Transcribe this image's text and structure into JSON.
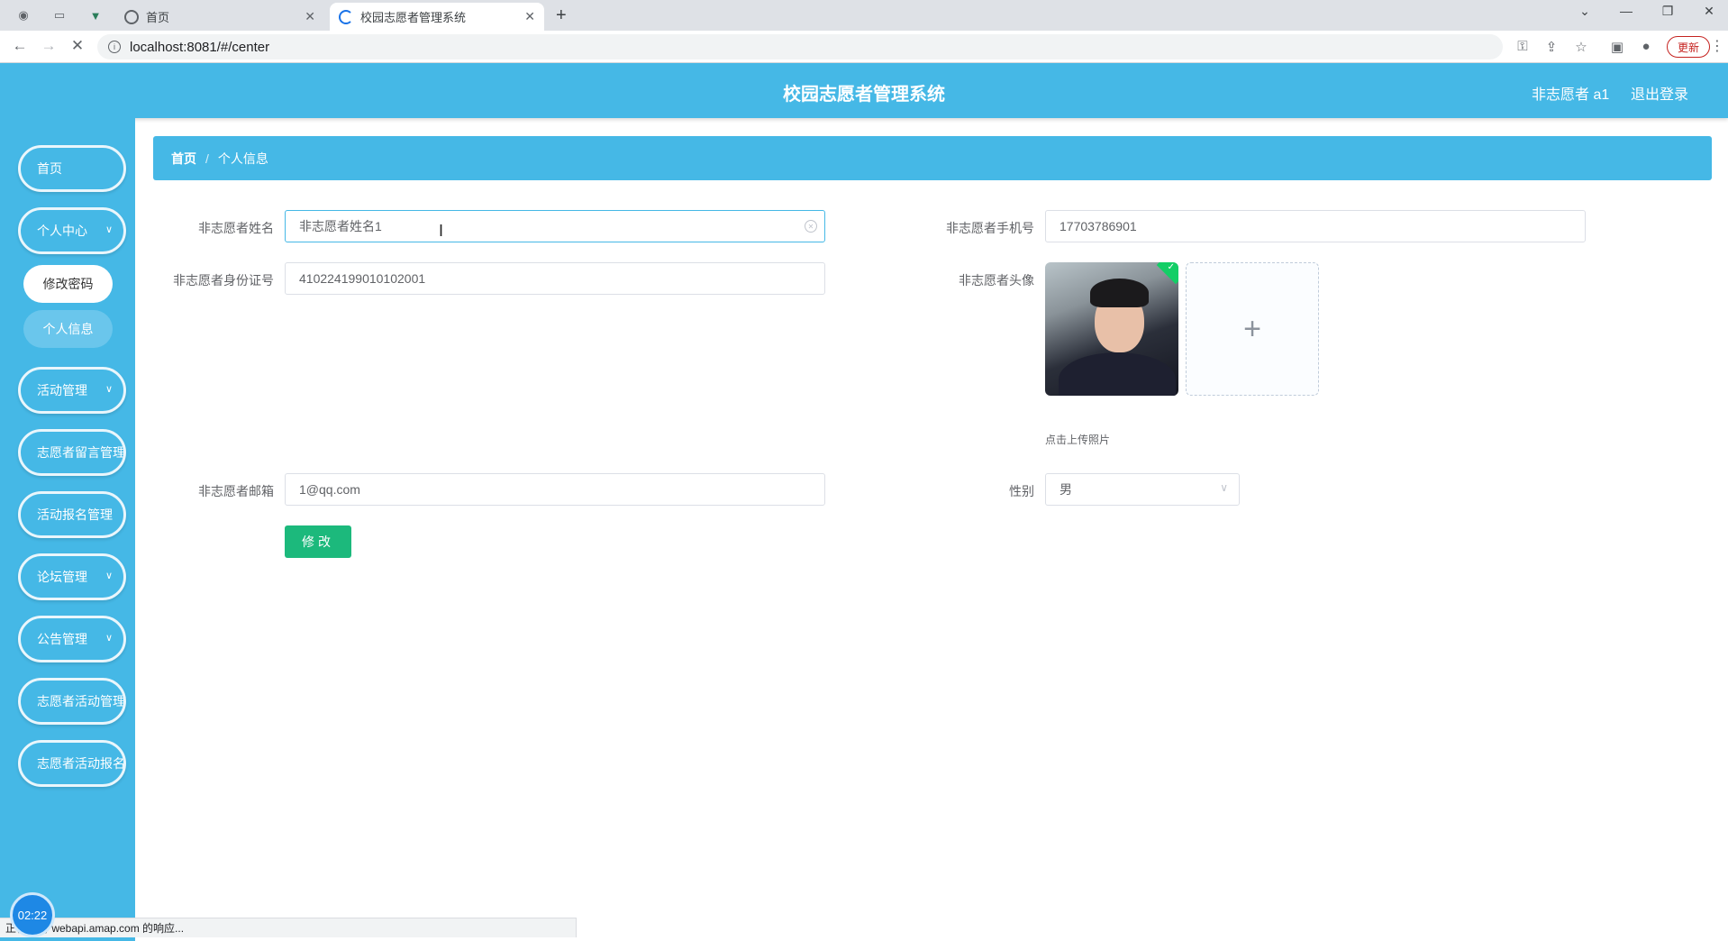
{
  "browser": {
    "tabs": [
      {
        "label": "首页",
        "active": false
      },
      {
        "label": "校园志愿者管理系统",
        "active": true
      }
    ],
    "url": "localhost:8081/#/center",
    "update_label": "更新",
    "status_text": "正在等待 webapi.amap.com 的响应..."
  },
  "header": {
    "title": "校园志愿者管理系统",
    "user": "非志愿者 a1",
    "logout": "退出登录"
  },
  "sidebar": {
    "items": [
      {
        "label": "首页",
        "has_arrow": false
      },
      {
        "label": "个人中心",
        "has_arrow": true
      },
      {
        "label": "活动管理",
        "has_arrow": true
      },
      {
        "label": "志愿者留言管理",
        "has_arrow": false
      },
      {
        "label": "活动报名管理",
        "has_arrow": false
      },
      {
        "label": "论坛管理",
        "has_arrow": true
      },
      {
        "label": "公告管理",
        "has_arrow": true
      },
      {
        "label": "志愿者活动管理",
        "has_arrow": false
      },
      {
        "label": "志愿者活动报名管理",
        "has_arrow": false
      }
    ],
    "sub_items": [
      {
        "label": "修改密码",
        "active": true
      },
      {
        "label": "个人信息",
        "active": false
      }
    ]
  },
  "breadcrumb": {
    "home": "首页",
    "separator": "/",
    "current": "个人信息"
  },
  "form": {
    "name_label": "非志愿者姓名",
    "name_value": "非志愿者姓名1",
    "phone_label": "非志愿者手机号",
    "phone_value": "17703786901",
    "idcard_label": "非志愿者身份证号",
    "idcard_value": "410224199010102001",
    "avatar_label": "非志愿者头像",
    "upload_tip": "点击上传照片",
    "upload_plus": "+",
    "email_label": "非志愿者邮箱",
    "email_value": "1@qq.com",
    "gender_label": "性别",
    "gender_value": "男",
    "submit_label": "修改"
  },
  "timer": "02:22",
  "colors": {
    "primary": "#45b8e6",
    "submit": "#1cb97c",
    "update": "#c5221f"
  }
}
